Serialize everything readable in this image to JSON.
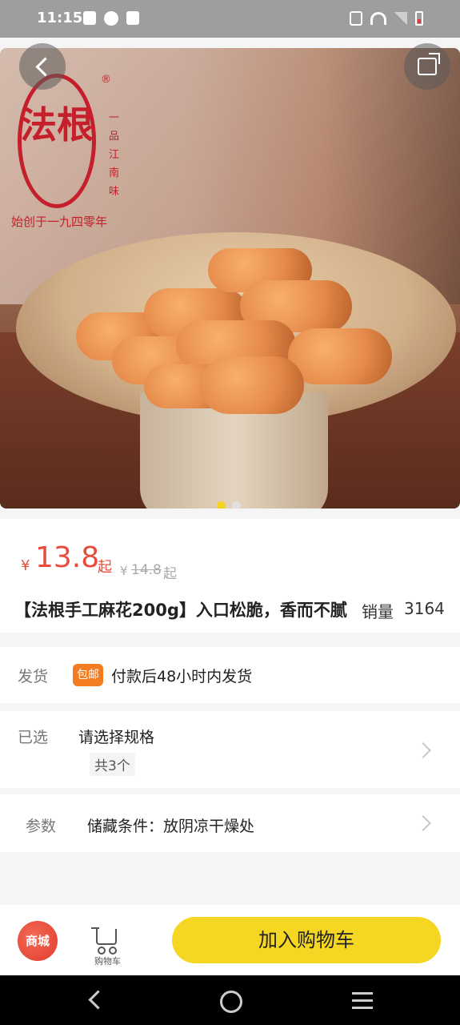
{
  "status_bar": {
    "time": "11:15",
    "left_icons": [
      "alert-icon",
      "timer-icon",
      "mail-icon"
    ],
    "right_icons": [
      "vibrate-icon",
      "wifi-icon",
      "signal-icon",
      "battery-icon"
    ]
  },
  "hero": {
    "brand_logo_text": "法根",
    "brand_side_text": "一品江南味",
    "brand_tagline": "始创于一九四零年",
    "reg_mark": "®",
    "carousel_dots": 2,
    "carousel_active_index": 0
  },
  "product": {
    "currency": "¥",
    "price": "13.8",
    "price_suffix": "起",
    "original_currency": "¥",
    "original_price": "14.8",
    "original_suffix": "起",
    "title": "【法根手工麻花200g】入口松脆，香而不腻",
    "sales_label": "销量",
    "sales_value": "3164"
  },
  "shipping": {
    "label": "发货",
    "tag": "包邮",
    "text": "付款后48小时内发货"
  },
  "spec": {
    "label": "已选",
    "text": "请选择规格",
    "count": "共3个"
  },
  "params": {
    "label": "参数",
    "text": "储藏条件：放阴凉干燥处"
  },
  "bottom": {
    "mall_label": "商城",
    "cart_label": "购物车",
    "add_cart_label": "加入购物车"
  },
  "colors": {
    "price": "#e74c3c",
    "accent_yellow": "#f5d723",
    "tag_orange": "#f47c20",
    "brand_red": "#c41f2b"
  }
}
